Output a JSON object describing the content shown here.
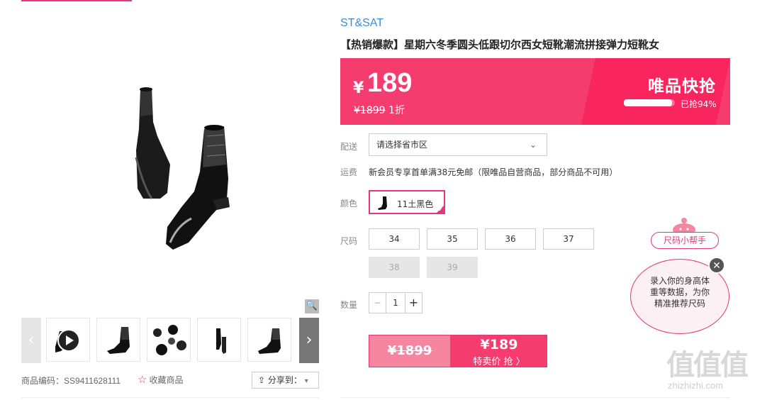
{
  "product": {
    "brand": "ST&SAT",
    "title": "【热销爆款】星期六冬季圆头低跟切尔西女短靴潮流拼接弹力短靴女",
    "code_label": "商品编码：SS9411628111",
    "favorite_label": "收藏商品",
    "share_label": "分享到："
  },
  "gallery": {
    "prev_icon": "chevron-left-icon",
    "next_icon": "chevron-right-icon",
    "thumb_count": 5
  },
  "price_banner": {
    "currency": "¥",
    "price": "189",
    "original_price": "¥1899",
    "discount": "1折",
    "event_logo": "唯品快抢",
    "sold_label": "已抢94%",
    "sold_fraction": 0.94,
    "colors": {
      "banner": "#f43c6f",
      "accent": "#e5367b"
    }
  },
  "delivery": {
    "label": "配送",
    "region_placeholder": "请选择省市区"
  },
  "shipping": {
    "label": "运费",
    "text": "新会员专享首单满38元免邮（限唯品自营商品，部分商品不可用）"
  },
  "color": {
    "label": "颜色",
    "selected": "11土黑色"
  },
  "size": {
    "label": "尺码",
    "options": [
      {
        "value": "34",
        "available": true
      },
      {
        "value": "35",
        "available": true
      },
      {
        "value": "36",
        "available": true
      },
      {
        "value": "37",
        "available": true
      },
      {
        "value": "38",
        "available": false
      },
      {
        "value": "39",
        "available": false
      }
    ]
  },
  "quantity": {
    "label": "数量",
    "value": "1",
    "minus": "−",
    "plus": "+"
  },
  "buy": {
    "original_price": "¥1899",
    "price": "¥189",
    "action_label": "特卖价 抢 〉"
  },
  "size_helper": {
    "tag": "尺码小帮手",
    "line1": "录入你的身高体",
    "line2": "重等数据，为你",
    "line3": "精准推荐尺码",
    "close": "✕"
  },
  "watermark": {
    "big": "值值值",
    "small": "zhizhizhi.com"
  }
}
